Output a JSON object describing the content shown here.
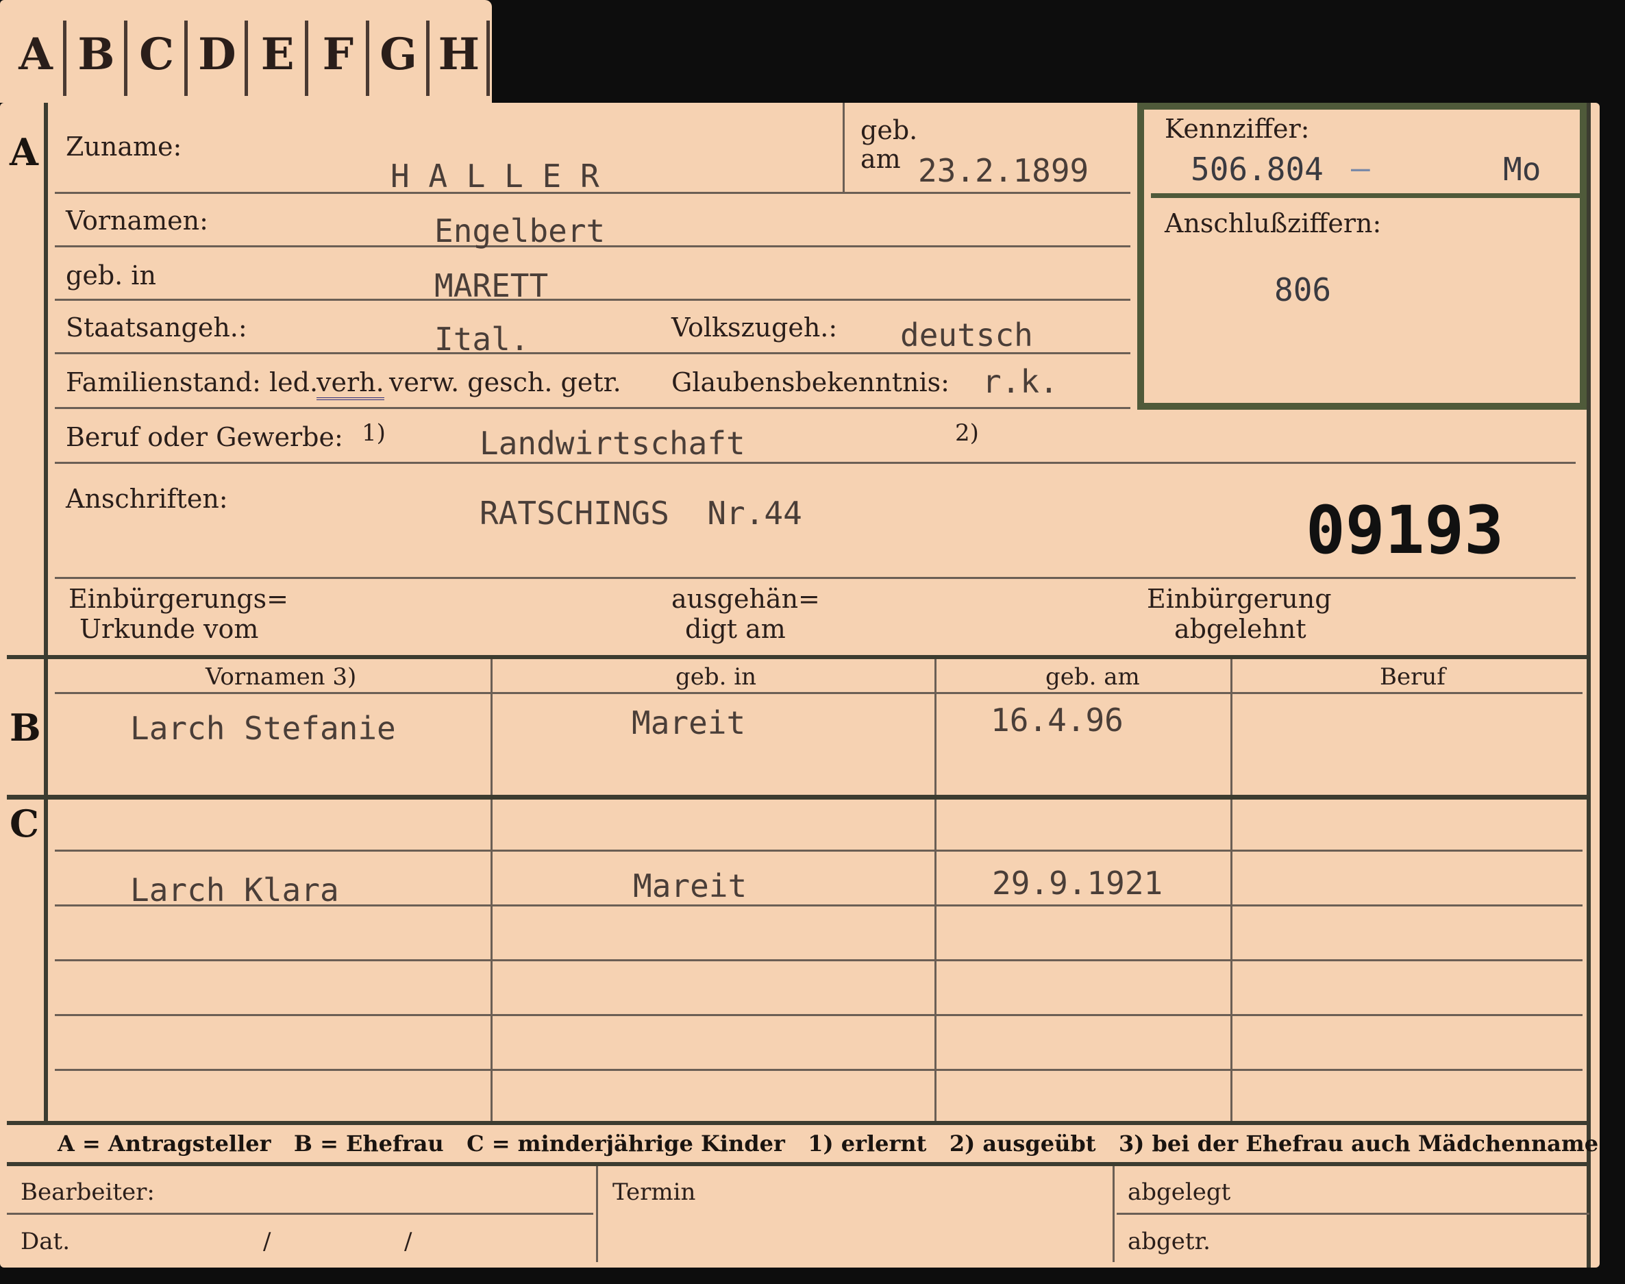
{
  "tabs": [
    "A",
    "B",
    "C",
    "D",
    "E",
    "F",
    "G",
    "H"
  ],
  "sections": {
    "a": "A",
    "b": "B",
    "c": "C"
  },
  "labels": {
    "zuname": "Zuname:",
    "geb": "geb.",
    "am": "am",
    "vornamen": "Vornamen:",
    "geb_in": "geb. in",
    "staatsangeh": "Staatsangeh.:",
    "volkszugeh": "Volkszugeh.:",
    "familienstand": "Familienstand: led.",
    "verh": "verh.",
    "familienstand_rest": "verw. gesch. getr.",
    "glaubens": "Glaubensbekenntnis:",
    "beruf": "Beruf oder Gewerbe:",
    "footnote1": "1)",
    "footnote2": "2)",
    "anschriften": "Anschriften:",
    "einb_urkunde_1": "Einbürgerungs=",
    "einb_urkunde_2": "Urkunde vom",
    "ausgeh_1": "ausgehän=",
    "ausgeh_2": "digt am",
    "einb_abgel_1": "Einbürgerung",
    "einb_abgel_2": "abgelehnt",
    "kennziffer": "Kennziffer:",
    "anschlussziffern": "Anschlußziffern:",
    "col_vornamen": "Vornamen 3)",
    "col_geb_in": "geb. in",
    "col_geb_am": "geb. am",
    "col_beruf": "Beruf",
    "bearbeiter": "Bearbeiter:",
    "dat": "Dat.",
    "slash1": "/",
    "slash2": "/",
    "termin": "Termin",
    "abgelegt": "abgelegt",
    "abgetr": "abgetr."
  },
  "values": {
    "zuname": "H A L L E R",
    "geb_am": "23.2.1899",
    "vornamen": "Engelbert",
    "geb_in": "MARETT",
    "staatsangeh": "Ital.",
    "volkszugeh": "deutsch",
    "glaubens": "r.k.",
    "beruf": "Landwirtschaft",
    "anschrift": "RATSCHINGS  Nr.44",
    "card_number": "09193",
    "kennziffer": "506.804",
    "kennziffer_dash": "–",
    "kennziffer_suffix": "Mo",
    "anschlussziffer": "806"
  },
  "spouse": {
    "vorname": "Larch Stefanie",
    "geb_in": "Mareit",
    "geb_am": "16.4.96",
    "beruf": ""
  },
  "children": [
    {
      "vorname": "Larch Klara",
      "geb_in": "Mareit",
      "geb_am": "29.9.1921",
      "beruf": ""
    }
  ],
  "legend": "A = Antragsteller   B = Ehefrau   C = minderjährige Kinder   1) erlernt   2) ausgeübt   3) bei der Ehefrau auch Mädchenname"
}
